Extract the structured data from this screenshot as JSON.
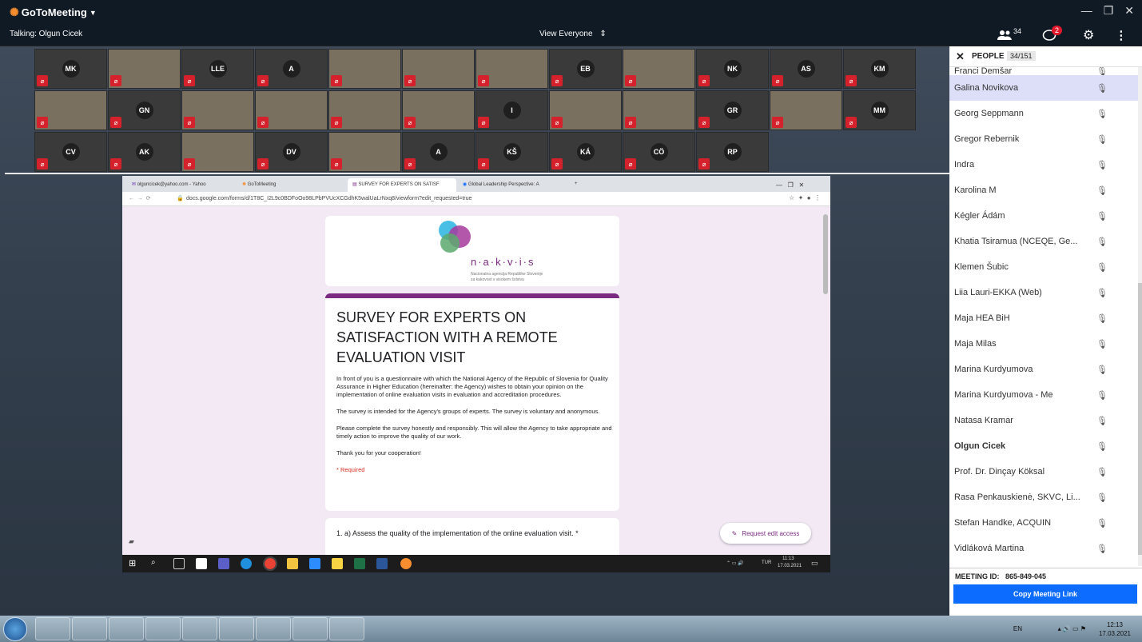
{
  "app": {
    "name": "GoToMeeting",
    "talking": "Talking: Olgun Cicek",
    "view_label": "View Everyone",
    "attendee_count": "34",
    "chat_badge": "2"
  },
  "tiles": [
    {
      "initials": "MK",
      "cam": false
    },
    {
      "initials": "",
      "cam": true
    },
    {
      "initials": "LLE",
      "cam": false
    },
    {
      "initials": "A",
      "cam": false
    },
    {
      "initials": "",
      "cam": true
    },
    {
      "initials": "",
      "cam": true
    },
    {
      "initials": "",
      "cam": true
    },
    {
      "initials": "EB",
      "cam": false
    },
    {
      "initials": "",
      "cam": true
    },
    {
      "initials": "NK",
      "cam": false
    },
    {
      "initials": "AS",
      "cam": false
    },
    {
      "initials": "KM",
      "cam": false
    },
    {
      "initials": "",
      "cam": true
    },
    {
      "initials": "GN",
      "cam": false
    },
    {
      "initials": "",
      "cam": true
    },
    {
      "initials": "",
      "cam": true
    },
    {
      "initials": "",
      "cam": true
    },
    {
      "initials": "",
      "cam": true
    },
    {
      "initials": "I",
      "cam": false
    },
    {
      "initials": "",
      "cam": true
    },
    {
      "initials": "",
      "cam": true
    },
    {
      "initials": "GR",
      "cam": false
    },
    {
      "initials": "",
      "cam": true
    },
    {
      "initials": "MM",
      "cam": false
    },
    {
      "initials": "CV",
      "cam": false
    },
    {
      "initials": "AK",
      "cam": false
    },
    {
      "initials": "",
      "cam": true
    },
    {
      "initials": "DV",
      "cam": false
    },
    {
      "initials": "",
      "cam": true
    },
    {
      "initials": "A",
      "cam": false
    },
    {
      "initials": "KŠ",
      "cam": false
    },
    {
      "initials": "KÁ",
      "cam": false
    },
    {
      "initials": "CÖ",
      "cam": false
    },
    {
      "initials": "RP",
      "cam": false
    }
  ],
  "browser": {
    "tabs": [
      "olguncicek@yahoo.com - Yahoo",
      "GoToMeeting",
      "SURVEY FOR EXPERTS ON SATISF",
      "Global Leadership Perspective: A"
    ],
    "url": "docs.google.com/forms/d/1T8C_I2L9c0BDFoOo98LPbPVUcXCGdhK5walUaLrNxq8/viewform?edit_requested=true"
  },
  "form": {
    "logo_text": "n·a·k·v·i·s",
    "logo_sub1": "Nacionalna agencija Republike Slovenije",
    "logo_sub2": "za kakovost v visokem šolstvu",
    "title": "SURVEY FOR EXPERTS ON SATISFACTION WITH A REMOTE EVALUATION VISIT",
    "p1": "In front of you is a questionnaire with which the National Agency of the Republic of Slovenia for Quality Assurance in Higher Education (hereinafter: the Agency) wishes to obtain your opinion on the implementation of online evaluation visits in evaluation and accreditation procedures.",
    "p2": "The survey is intended for the Agency's groups of experts. The survey is voluntary and anonymous.",
    "p3": "Please complete the survey honestly and responsibly. This will allow the Agency to take appropriate and timely action to improve the quality of our work.",
    "p4": "Thank you for your cooperation!",
    "required": "* Required",
    "q1": "1. a) Assess the quality of the implementation of the online evaluation visit. *",
    "request_edit": "Request edit access"
  },
  "inner_taskbar": {
    "time": "11:13",
    "date": "17.03.2021",
    "lang": "TUR"
  },
  "people": {
    "title": "PEOPLE",
    "count": "34/151",
    "list": [
      {
        "name": "Franci Demšar",
        "sel": false
      },
      {
        "name": "Galina Novikova",
        "sel": true
      },
      {
        "name": "Georg Seppmann",
        "sel": false
      },
      {
        "name": "Gregor Rebernik",
        "sel": false
      },
      {
        "name": "Indra",
        "sel": false
      },
      {
        "name": "Karolina M",
        "sel": false
      },
      {
        "name": "Kégler Ádám",
        "sel": false
      },
      {
        "name": "Khatia Tsiramua (NCEQE, Ge...",
        "sel": false
      },
      {
        "name": "Klemen Šubic",
        "sel": false
      },
      {
        "name": "Liia Lauri-EKKA  (Web)",
        "sel": false
      },
      {
        "name": "Maja HEA BiH",
        "sel": false
      },
      {
        "name": "Maja Milas",
        "sel": false
      },
      {
        "name": "Marina Kurdyumova",
        "sel": false
      },
      {
        "name": "Marina Kurdyumova  - Me",
        "sel": false
      },
      {
        "name": "Natasa Kramar",
        "sel": false
      },
      {
        "name": "Olgun Cicek",
        "sel": false
      },
      {
        "name": "Prof. Dr. Dinçay Köksal",
        "sel": false
      },
      {
        "name": "Rasa Penkauskienė, SKVC, Li...",
        "sel": false
      },
      {
        "name": "Stefan Handke, ACQUIN",
        "sel": false
      },
      {
        "name": "Vidláková Martina",
        "sel": false
      }
    ],
    "meeting_id_label": "MEETING ID:",
    "meeting_id": "865-849-045",
    "copy_link": "Copy Meeting Link"
  },
  "taskbar": {
    "lang": "EN",
    "time": "12:13",
    "date": "17.03.2021"
  },
  "colors": {
    "accent": "#0b6cff",
    "form_purple": "#7b2a82",
    "mute_red": "#d4212b"
  }
}
